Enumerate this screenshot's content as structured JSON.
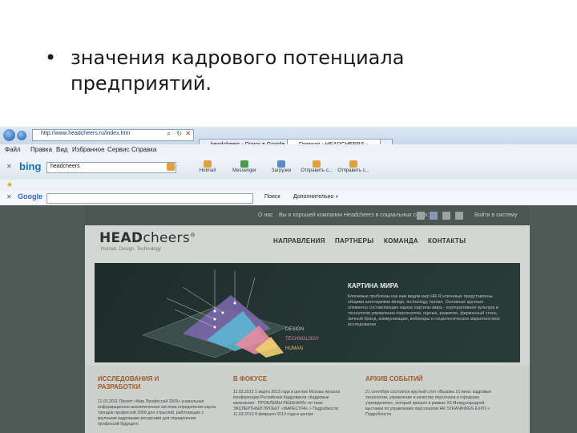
{
  "slide": {
    "bullet": "•",
    "text": "значения кадрового потенциала предприятий."
  },
  "browser": {
    "url": "http://www.headcheers.ru/index.htm",
    "tabs": [
      {
        "label": "headcheers - Поиск в Google"
      },
      {
        "label": "Главная - HEADCHEERS - ..."
      }
    ],
    "menu": [
      "Файл",
      "Правка",
      "Вид",
      "Избранное",
      "Сервис",
      "Справка"
    ],
    "bing_label": "bing",
    "bing_query": "headcheers",
    "toolbar_buttons": [
      "Hotmail",
      "Messenger",
      "Загрузки",
      "Отправить с...",
      "Отправить с..."
    ],
    "google_label": "Google",
    "google_search": "Поиск",
    "google_more": "Дополнительно »"
  },
  "site": {
    "top_links": [
      "О нас",
      "Вы в хорошей компании",
      "Headcheers в социальных сетях:"
    ],
    "top_right": "Войти в систему",
    "logo_bold": "HEAD",
    "logo_light": "cheers",
    "logo_mark": "®",
    "tagline": "Human. Design. Technology",
    "nav": [
      "НАПРАВЛЕНИЯ",
      "ПАРТНЕРЫ",
      "КОМАНДА",
      "КОНТАКТЫ"
    ],
    "hero": {
      "title": "КАРТИНА МИРА",
      "text": "Ключевые проблемы как нам видим мир HR-Я ключевые представлены общими категориями design, technology, human. Основные крупные элементы составляющие каркас картины мира - корпоративная культура и технологии управления персоналом, оценка, развитие, фирменный стиль, личный бренд, коммуникации, вебинары и социологическое маркетинговое исследование",
      "labels": [
        "DESIGN",
        "TECHNOLOGY",
        "HUMAN"
      ]
    },
    "columns": [
      {
        "heading": "ИССЛЕДОВАНИЯ И РАЗРАБОТКИ",
        "text": "11.03.2011 Проект «Мир Профессий 2009» уникальная информационно-аналитическая система определения карты трендов профессий 2009 для отраслей, работающих с крупными кадровыми ресурсами для определения профессий будущего"
      },
      {
        "heading": "В ФОКУСЕ",
        "text": "11.03.2012 1 марта 2013 года в центре Москвы прошла конференция Российских Кадровиков «Кадровые изменения - ПРОБЛЕМЫ РЕШЕНИЯ» по теме ЭКСПЕРТНЫЙ ПРОЕКТ «МАРЕСТРА» » Подробности 11.03.2013 8 февраля 2013 года в центре"
      },
      {
        "heading": "АРХИВ СОБЫТИЙ",
        "text": "21 сентября состоялся круглый стол «Вызовы 21 века: кадровые технологии, управление и качество персонала в городских учреждениях», который прошел в рамках ХII Международной выставки по управлению персоналом HR STRANKINGS EXPO » Подробности"
      }
    ]
  }
}
